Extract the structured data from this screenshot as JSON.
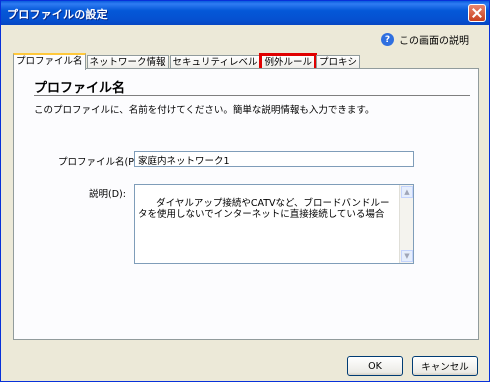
{
  "window": {
    "title": "プロファイルの設定"
  },
  "help": {
    "label": "この画面の説明",
    "icon": "help-icon"
  },
  "tabs": [
    {
      "label": "プロファイル名",
      "active": true,
      "highlighted": false
    },
    {
      "label": "ネットワーク情報",
      "active": false,
      "highlighted": false
    },
    {
      "label": "セキュリティレベル",
      "active": false,
      "highlighted": false
    },
    {
      "label": "例外ルール",
      "active": false,
      "highlighted": true
    },
    {
      "label": "プロキシ",
      "active": false,
      "highlighted": false
    }
  ],
  "panel": {
    "title": "プロファイル名",
    "description": "このプロファイルに、名前を付けてください。簡単な説明情報も入力できます。"
  },
  "form": {
    "name_label": "プロファイル名(P):",
    "name_value": "家庭内ネットワーク1",
    "desc_label": "説明(D):",
    "desc_value": "ダイヤルアップ接続やCATVなど、ブロードバンドルータを使用しないでインターネットに直接接続している場合"
  },
  "buttons": {
    "ok": "OK",
    "cancel": "キャンセル"
  },
  "colors": {
    "titlebar": "#0458d8",
    "highlight_border": "#e00000",
    "active_tab_accent": "#ffc83c"
  }
}
